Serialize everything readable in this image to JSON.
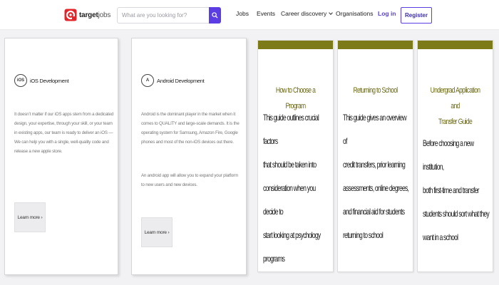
{
  "header": {
    "logo_text": "target",
    "logo_text_suffix": "jobs",
    "search_placeholder": "What are you looking for?",
    "nav": {
      "jobs": "Jobs",
      "events": "Events",
      "career_discovery": "Career discovery",
      "organisations": "Organisations",
      "login": "Log in"
    },
    "register": "Register"
  },
  "dev_cards": [
    {
      "icon_text": "iOS",
      "title": "iOS Development",
      "body": "It doesn’t matter if our iOS apps stem from a dedicated design, your expertise, through your skill, or your team in existing apps, our team is ready to deliver an iOS — We can help you with a single, well-quality code and release a new apple store.",
      "button": "Learn more ›"
    },
    {
      "icon_text": "A",
      "title": "Android Development",
      "body": "Android is the dominant player in the market when it comes to QUALITY and large-scale demands. It is the operating system for Samsung, Amazon Fire, Google phones and most of the non-iOS devices out there.",
      "body2": "An android app will allow you to expand your platform to new users and new devices.",
      "button": "Learn more ›"
    }
  ],
  "guides": [
    {
      "title_lines": [
        "How to Choose a Program"
      ],
      "body_lines": [
        "This guide outlines crucial factors",
        "that should be taken into",
        "consideration when you decide to",
        "start looking at psychology",
        "programs"
      ]
    },
    {
      "title_lines": [
        "Returning to School"
      ],
      "body_lines": [
        "This guide gives an overview of",
        "credit transfers, prior learning",
        "assessments, online degrees,",
        "and financial aid for students",
        "returning to school"
      ]
    },
    {
      "title_lines": [
        "Undergrad Application and",
        "Transfer Guide"
      ],
      "body_lines": [
        "Before choosing a new institution,",
        "both first-time and transfer",
        "students should sort what they",
        "want in a school"
      ]
    }
  ],
  "colors": {
    "accent": "#5b3de3",
    "logo_red": "#e3262b",
    "guide_bar": "#7d7a1a",
    "guide_title": "#6d6a12"
  }
}
